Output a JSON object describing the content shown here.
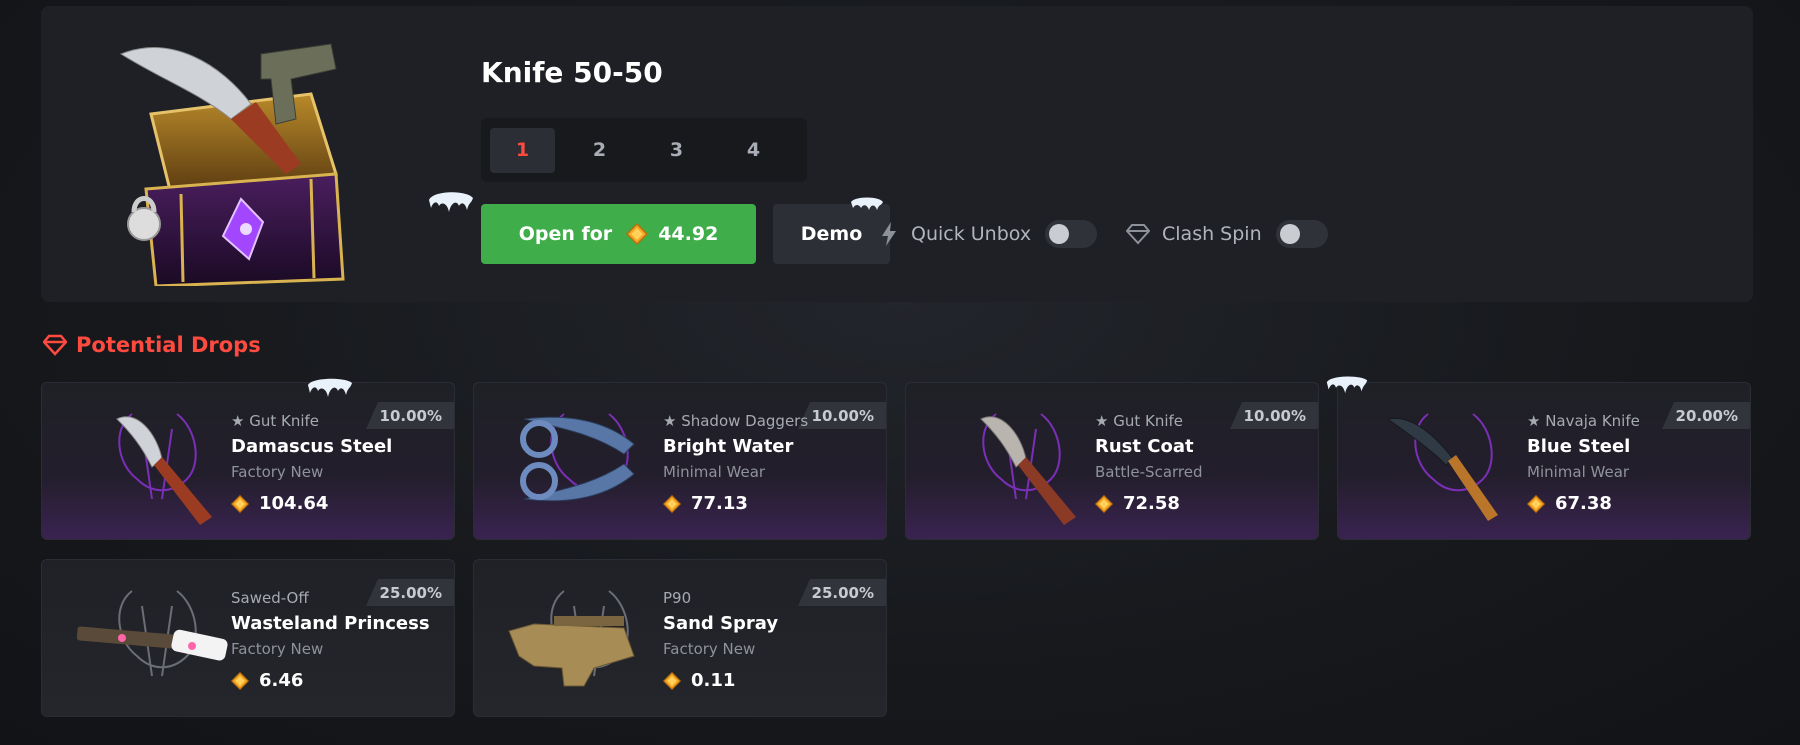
{
  "case": {
    "title": "Knife 50-50",
    "count_tabs": [
      "1",
      "2",
      "3",
      "4"
    ],
    "active_count": "1",
    "open_label": "Open for",
    "open_price": "44.92",
    "demo_label": "Demo",
    "quick_unbox_label": "Quick Unbox",
    "clash_spin_label": "Clash Spin",
    "quick_unbox_on": false,
    "clash_spin_on": false
  },
  "drops": {
    "title": "Potential Drops",
    "items": [
      {
        "weapon": "★ Gut Knife",
        "skin": "Damascus Steel",
        "wear": "Factory New",
        "price": "104.64",
        "odds": "10.00%",
        "tier": "purple",
        "icon": "gut-knife-icon"
      },
      {
        "weapon": "★ Shadow Daggers",
        "skin": "Bright Water",
        "wear": "Minimal Wear",
        "price": "77.13",
        "odds": "10.00%",
        "tier": "purple",
        "icon": "shadow-daggers-icon"
      },
      {
        "weapon": "★ Gut Knife",
        "skin": "Rust Coat",
        "wear": "Battle-Scarred",
        "price": "72.58",
        "odds": "10.00%",
        "tier": "purple",
        "icon": "gut-knife-icon"
      },
      {
        "weapon": "★ Navaja Knife",
        "skin": "Blue Steel",
        "wear": "Minimal Wear",
        "price": "67.38",
        "odds": "20.00%",
        "tier": "purple",
        "icon": "navaja-knife-icon"
      },
      {
        "weapon": "Sawed-Off",
        "skin": "Wasteland Princess",
        "wear": "Factory New",
        "price": "6.46",
        "odds": "25.00%",
        "tier": "grey",
        "icon": "sawed-off-icon"
      },
      {
        "weapon": "P90",
        "skin": "Sand Spray",
        "wear": "Factory New",
        "price": "0.11",
        "odds": "25.00%",
        "tier": "grey",
        "icon": "p90-icon"
      }
    ]
  },
  "colors": {
    "accent_red": "#ff4a40",
    "open_green": "#3fae4a",
    "card_bg": "#1e2025",
    "purple_glow": "#3a2350",
    "coin_gold": "#f5a623"
  }
}
